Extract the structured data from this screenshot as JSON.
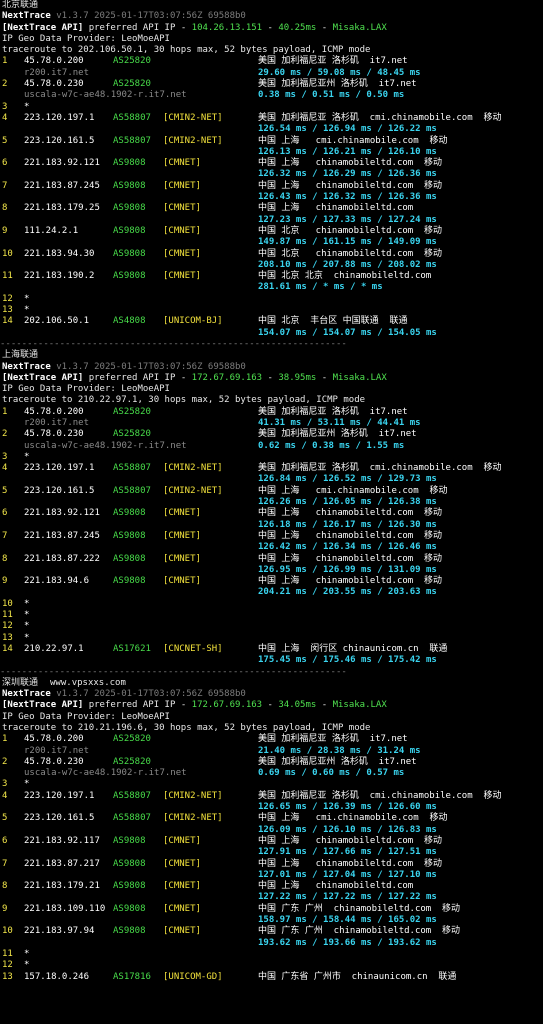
{
  "blocks": [
    {
      "title": "北京联通",
      "site": "",
      "app": "NextTrace",
      "version": "v1.3.7 2025-01-17T03:07:56Z 69588b0",
      "api_prefix": "[NextTrace API]",
      "api_pref": " preferred API IP - ",
      "api_ip": "104.26.13.151",
      "api_sep1": " - ",
      "api_ms": "40.25ms",
      "api_sep2": " - ",
      "api_node": "Misaka.LAX",
      "geo_provider": "IP Geo Data Provider: LeoMoeAPI",
      "traceroute": "traceroute to 202.106.50.1, 30 hops max, 52 bytes payload, ICMP mode",
      "hops": [
        {
          "n": "1",
          "ip": "45.78.0.200",
          "asn": "AS25820",
          "tag": "",
          "geo": "美国 加利福尼亚 洛杉矶  it7.net",
          "host": "r200.it7.net",
          "rtt": "29.60 ms / 59.08 ms / 48.45 ms"
        },
        {
          "n": "2",
          "ip": "45.78.0.230",
          "asn": "AS25820",
          "tag": "",
          "geo": "美国 加利福尼亚州 洛杉矶  it7.net",
          "host": "uscala-w7c-ae48.1902-r.it7.net",
          "rtt": "0.38 ms / 0.51 ms / 0.50 ms"
        },
        {
          "n": "3",
          "ip": "*"
        },
        {
          "n": "4",
          "ip": "223.120.197.1",
          "asn": "AS58807",
          "tag": "[CMIN2-NET]",
          "geo": "美国 加利福尼亚 洛杉矶  cmi.chinamobile.com  移动",
          "host": "",
          "rtt": "126.54 ms / 126.94 ms / 126.22 ms"
        },
        {
          "n": "5",
          "ip": "223.120.161.5",
          "asn": "AS58807",
          "tag": "[CMIN2-NET]",
          "geo": "中国 上海   cmi.chinamobile.com  移动",
          "host": "",
          "rtt": "126.13 ms / 126.21 ms / 126.10 ms"
        },
        {
          "n": "6",
          "ip": "221.183.92.121",
          "asn": "AS9808",
          "tag": "[CMNET]",
          "geo": "中国 上海   chinamobileltd.com  移动",
          "host": "",
          "rtt": "126.32 ms / 126.29 ms / 126.36 ms"
        },
        {
          "n": "7",
          "ip": "221.183.87.245",
          "asn": "AS9808",
          "tag": "[CMNET]",
          "geo": "中国 上海   chinamobileltd.com  移动",
          "host": "",
          "rtt": "126.43 ms / 126.32 ms / 126.36 ms"
        },
        {
          "n": "8",
          "ip": "221.183.179.25",
          "asn": "AS9808",
          "tag": "[CMNET]",
          "geo": "中国 上海   chinamobileltd.com",
          "host": "",
          "rtt": "127.23 ms / 127.33 ms / 127.24 ms"
        },
        {
          "n": "9",
          "ip": "111.24.2.1",
          "asn": "AS9808",
          "tag": "[CMNET]",
          "geo": "中国 北京   chinamobileltd.com  移动",
          "host": "",
          "rtt": "149.87 ms / 161.15 ms / 149.09 ms"
        },
        {
          "n": "10",
          "ip": "221.183.94.30",
          "asn": "AS9808",
          "tag": "[CMNET]",
          "geo": "中国 北京   chinamobileltd.com  移动",
          "host": "",
          "rtt": "208.10 ms / 207.88 ms / 208.02 ms"
        },
        {
          "n": "11",
          "ip": "221.183.190.2",
          "asn": "AS9808",
          "tag": "[CMNET]",
          "geo": "中国 北京 北京  chinamobileltd.com",
          "host": "",
          "rtt": "281.61 ms / * ms / * ms"
        },
        {
          "n": "12",
          "ip": "*"
        },
        {
          "n": "13",
          "ip": "*"
        },
        {
          "n": "14",
          "ip": "202.106.50.1",
          "asn": "AS4808",
          "tag": "[UNICOM-BJ]",
          "geo": "中国 北京  丰台区 中国联通  联通",
          "host": "",
          "rtt": "154.07 ms / 154.07 ms / 154.05 ms"
        }
      ],
      "separator": "----------------------------------------------------------------"
    },
    {
      "title": "上海联通",
      "site": "",
      "app": "NextTrace",
      "version": "v1.3.7 2025-01-17T03:07:56Z 69588b0",
      "api_prefix": "[NextTrace API]",
      "api_pref": " preferred API IP - ",
      "api_ip": "172.67.69.163",
      "api_sep1": " - ",
      "api_ms": "38.95ms",
      "api_sep2": " - ",
      "api_node": "Misaka.LAX",
      "geo_provider": "IP Geo Data Provider: LeoMoeAPI",
      "traceroute": "traceroute to 210.22.97.1, 30 hops max, 52 bytes payload, ICMP mode",
      "hops": [
        {
          "n": "1",
          "ip": "45.78.0.200",
          "asn": "AS25820",
          "tag": "",
          "geo": "美国 加利福尼亚 洛杉矶  it7.net",
          "host": "r200.it7.net",
          "rtt": "41.31 ms / 53.11 ms / 44.41 ms"
        },
        {
          "n": "2",
          "ip": "45.78.0.230",
          "asn": "AS25820",
          "tag": "",
          "geo": "美国 加利福尼亚州 洛杉矶  it7.net",
          "host": "uscala-w7c-ae48.1902-r.it7.net",
          "rtt": "0.62 ms / 0.38 ms / 1.55 ms"
        },
        {
          "n": "3",
          "ip": "*"
        },
        {
          "n": "4",
          "ip": "223.120.197.1",
          "asn": "AS58807",
          "tag": "[CMIN2-NET]",
          "geo": "美国 加利福尼亚 洛杉矶  cmi.chinamobile.com  移动",
          "host": "",
          "rtt": "126.84 ms / 126.52 ms / 129.73 ms"
        },
        {
          "n": "5",
          "ip": "223.120.161.5",
          "asn": "AS58807",
          "tag": "[CMIN2-NET]",
          "geo": "中国 上海   cmi.chinamobile.com  移动",
          "host": "",
          "rtt": "126.26 ms / 126.05 ms / 126.38 ms"
        },
        {
          "n": "6",
          "ip": "221.183.92.121",
          "asn": "AS9808",
          "tag": "[CMNET]",
          "geo": "中国 上海   chinamobileltd.com  移动",
          "host": "",
          "rtt": "126.18 ms / 126.17 ms / 126.30 ms"
        },
        {
          "n": "7",
          "ip": "221.183.87.245",
          "asn": "AS9808",
          "tag": "[CMNET]",
          "geo": "中国 上海   chinamobileltd.com  移动",
          "host": "",
          "rtt": "126.42 ms / 126.34 ms / 126.46 ms"
        },
        {
          "n": "8",
          "ip": "221.183.87.222",
          "asn": "AS9808",
          "tag": "[CMNET]",
          "geo": "中国 上海   chinamobileltd.com  移动",
          "host": "",
          "rtt": "126.95 ms / 126.99 ms / 131.09 ms"
        },
        {
          "n": "9",
          "ip": "221.183.94.6",
          "asn": "AS9808",
          "tag": "[CMNET]",
          "geo": "中国 上海   chinamobileltd.com  移动",
          "host": "",
          "rtt": "204.21 ms / 203.55 ms / 203.63 ms"
        },
        {
          "n": "10",
          "ip": "*"
        },
        {
          "n": "11",
          "ip": "*"
        },
        {
          "n": "12",
          "ip": "*"
        },
        {
          "n": "13",
          "ip": "*"
        },
        {
          "n": "14",
          "ip": "210.22.97.1",
          "asn": "AS17621",
          "tag": "[CNCNET-SH]",
          "geo": "中国 上海  闵行区 chinaunicom.cn  联通",
          "host": "",
          "rtt": "175.45 ms / 175.46 ms / 175.42 ms"
        }
      ],
      "separator": "----------------------------------------------------------------"
    },
    {
      "title": "深圳联通",
      "site": "www.vpsxxs.com",
      "app": "NextTrace",
      "version": "v1.3.7 2025-01-17T03:07:56Z 69588b0",
      "api_prefix": "[NextTrace API]",
      "api_pref": " preferred API IP - ",
      "api_ip": "172.67.69.163",
      "api_sep1": " - ",
      "api_ms": "34.05ms",
      "api_sep2": " - ",
      "api_node": "Misaka.LAX",
      "geo_provider": "IP Geo Data Provider: LeoMoeAPI",
      "traceroute": "traceroute to 210.21.196.6, 30 hops max, 52 bytes payload, ICMP mode",
      "hops": [
        {
          "n": "1",
          "ip": "45.78.0.200",
          "asn": "AS25820",
          "tag": "",
          "geo": "美国 加利福尼亚 洛杉矶  it7.net",
          "host": "r200.it7.net",
          "rtt": "21.40 ms / 28.38 ms / 31.24 ms"
        },
        {
          "n": "2",
          "ip": "45.78.0.230",
          "asn": "AS25820",
          "tag": "",
          "geo": "美国 加利福尼亚州 洛杉矶  it7.net",
          "host": "uscala-w7c-ae48.1902-r.it7.net",
          "rtt": "0.69 ms / 0.60 ms / 0.57 ms"
        },
        {
          "n": "3",
          "ip": "*"
        },
        {
          "n": "4",
          "ip": "223.120.197.1",
          "asn": "AS58807",
          "tag": "[CMIN2-NET]",
          "geo": "美国 加利福尼亚 洛杉矶  cmi.chinamobile.com  移动",
          "host": "",
          "rtt": "126.65 ms / 126.39 ms / 126.60 ms"
        },
        {
          "n": "5",
          "ip": "223.120.161.5",
          "asn": "AS58807",
          "tag": "[CMIN2-NET]",
          "geo": "中国 上海   cmi.chinamobile.com  移动",
          "host": "",
          "rtt": "126.09 ms / 126.10 ms / 126.83 ms"
        },
        {
          "n": "6",
          "ip": "221.183.92.117",
          "asn": "AS9808",
          "tag": "[CMNET]",
          "geo": "中国 上海   chinamobileltd.com  移动",
          "host": "",
          "rtt": "127.91 ms / 127.66 ms / 127.51 ms"
        },
        {
          "n": "7",
          "ip": "221.183.87.217",
          "asn": "AS9808",
          "tag": "[CMNET]",
          "geo": "中国 上海   chinamobileltd.com  移动",
          "host": "",
          "rtt": "127.01 ms / 127.04 ms / 127.10 ms"
        },
        {
          "n": "8",
          "ip": "221.183.179.21",
          "asn": "AS9808",
          "tag": "[CMNET]",
          "geo": "中国 上海   chinamobileltd.com",
          "host": "",
          "rtt": "127.22 ms / 127.22 ms / 127.22 ms"
        },
        {
          "n": "9",
          "ip": "221.183.109.110",
          "asn": "AS9808",
          "tag": "[CMNET]",
          "geo": "中国 广东 广州  chinamobileltd.com  移动",
          "host": "",
          "rtt": "158.97 ms / 158.44 ms / 165.02 ms"
        },
        {
          "n": "10",
          "ip": "221.183.97.94",
          "asn": "AS9808",
          "tag": "[CMNET]",
          "geo": "中国 广东 广州  chinamobileltd.com  移动",
          "host": "",
          "rtt": "193.62 ms / 193.66 ms / 193.62 ms"
        },
        {
          "n": "11",
          "ip": "*"
        },
        {
          "n": "12",
          "ip": "*"
        },
        {
          "n": "13",
          "ip": "157.18.0.246",
          "asn": "AS17816",
          "tag": "[UNICOM-GD]",
          "geo": "中国 广东省 广州市  chinaunicom.cn  联通",
          "host": "",
          "rtt": "",
          "cut": true
        }
      ],
      "separator": ""
    }
  ]
}
